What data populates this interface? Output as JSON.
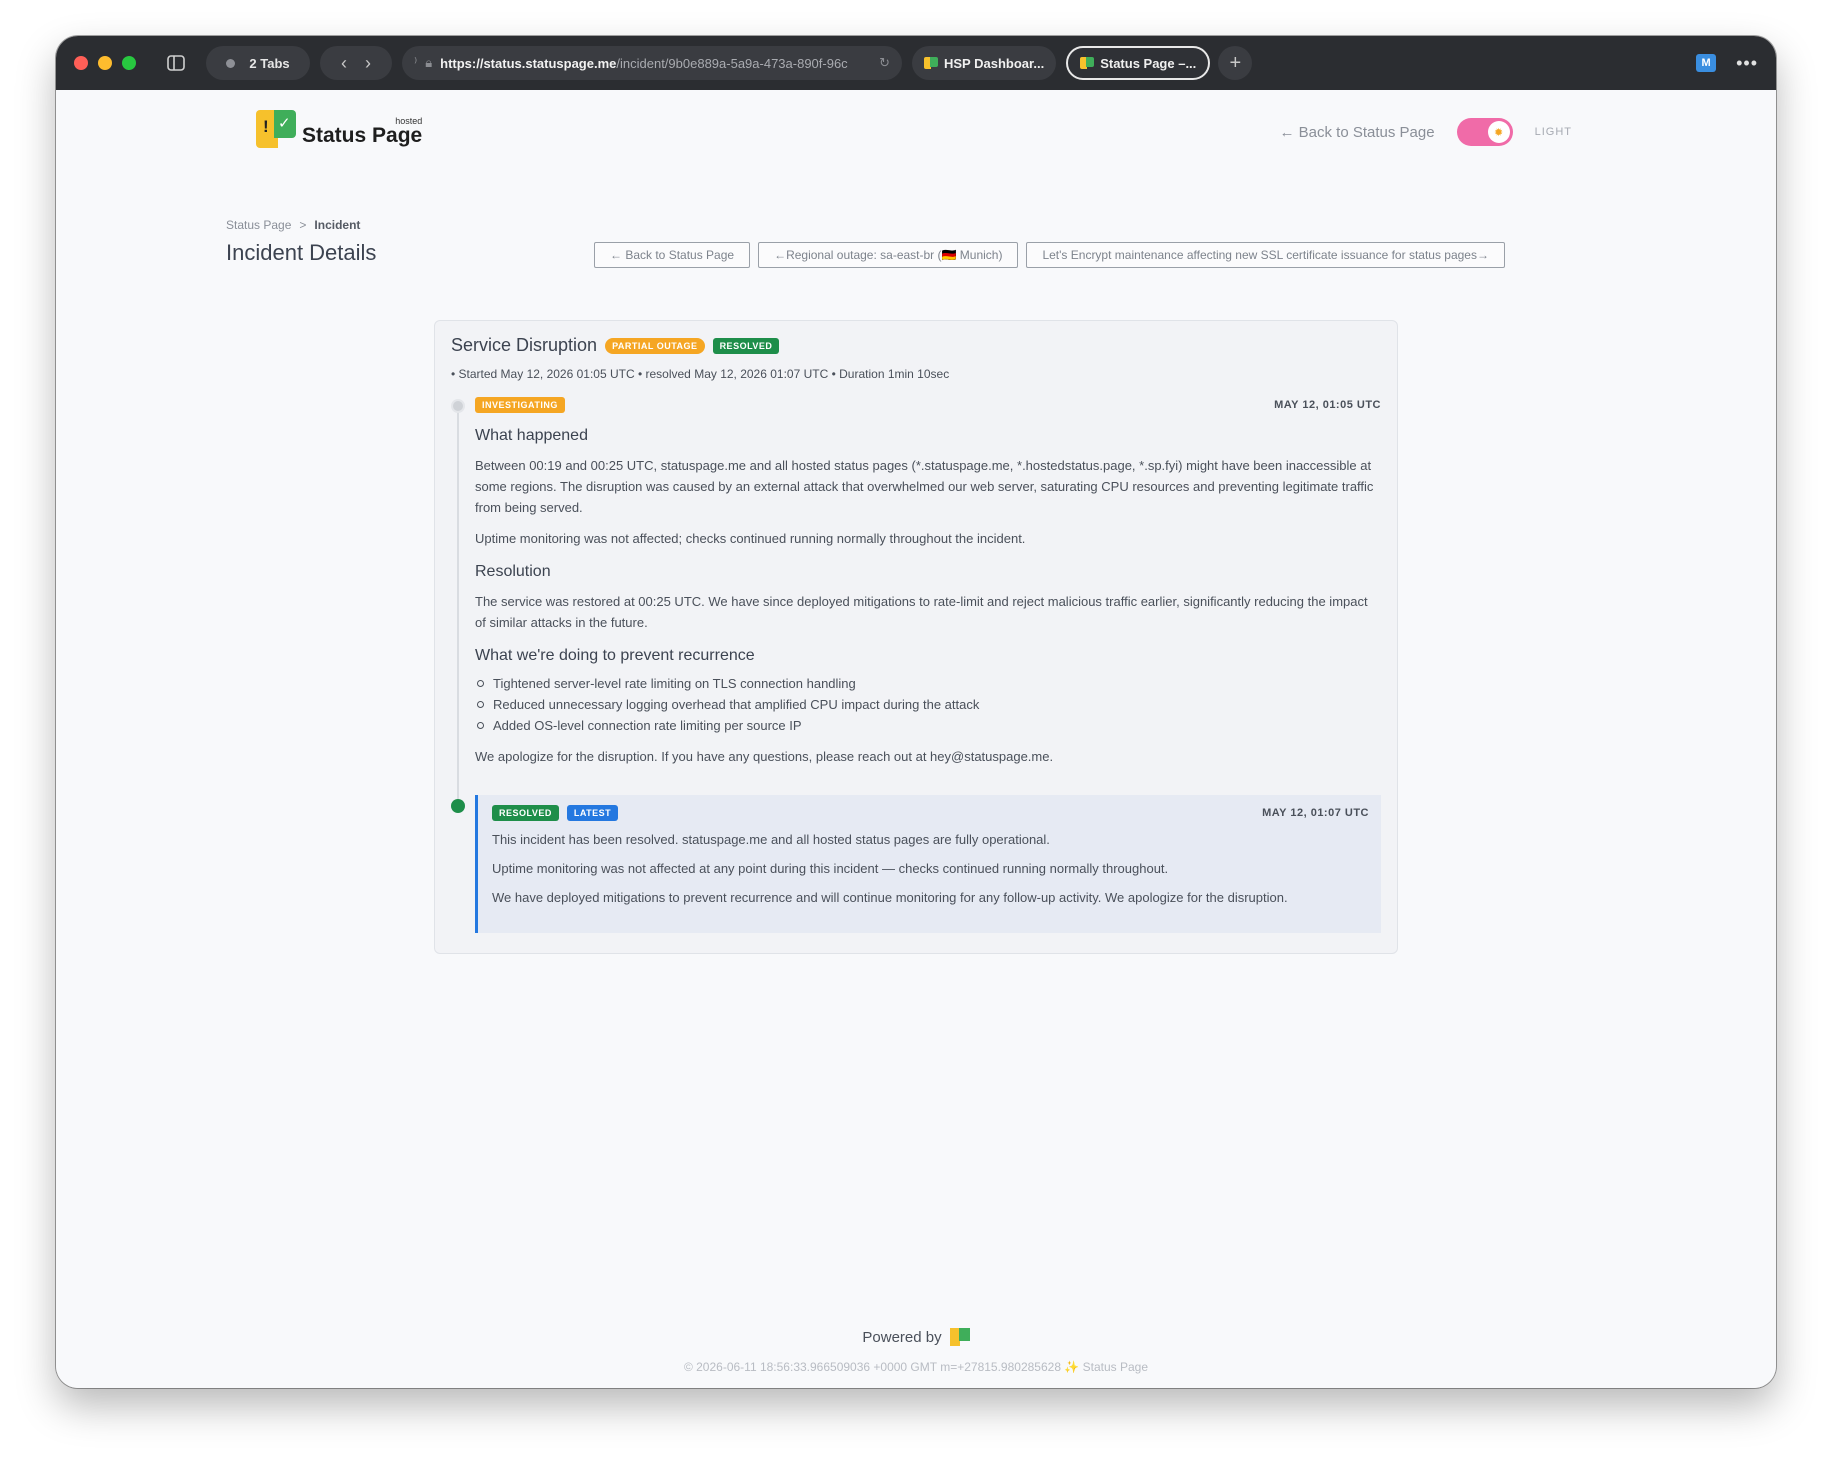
{
  "browser": {
    "tabs_count": "2 Tabs",
    "url_host": "https://status.statuspage.me",
    "url_path": "/incident/9b0e889a-5a9a-473a-890f-96c",
    "tab1": "HSP Dashboar...",
    "tab2": "Status Page –...",
    "ext_label": "M"
  },
  "header": {
    "logo_sup": "hosted",
    "logo_name": "Status Page",
    "back_link": "← Back to Status Page",
    "theme_label": "LIGHT"
  },
  "breadcrumb": {
    "root": "Status Page",
    "sep": ">",
    "current": "Incident"
  },
  "page_title": "Incident Details",
  "nav_buttons": {
    "back": "← Back to Status Page",
    "prev": "←Regional outage: sa-east-br (🇩🇪 Munich)",
    "next": "Let's Encrypt maintenance affecting new SSL certificate issuance for status pages→"
  },
  "incident": {
    "title": "Service Disruption",
    "impact_badge": "PARTIAL OUTAGE",
    "status_badge": "RESOLVED",
    "meta": "• Started May 12, 2026 01:05 UTC • resolved May 12, 2026 01:07 UTC • Duration 1min 10sec",
    "update1": {
      "badge": "INVESTIGATING",
      "time": "MAY 12, 01:05 UTC",
      "h1": "What happened",
      "p1": "Between 00:19 and 00:25 UTC, statuspage.me and all hosted status pages (*.statuspage.me, *.hostedstatus.page, *.sp.fyi) might have been inaccessible at some regions. The disruption was caused by an external attack that overwhelmed our web server, saturating CPU resources and preventing legitimate traffic from being served.",
      "p2": "Uptime monitoring was not affected; checks continued running normally throughout the incident.",
      "h2": "Resolution",
      "p3": "The service was restored at 00:25 UTC. We have since deployed mitigations to rate-limit and reject malicious traffic earlier, significantly reducing the impact of similar attacks in the future.",
      "h3": "What we're doing to prevent recurrence",
      "items": [
        "Tightened server-level rate limiting on TLS connection handling",
        "Reduced unnecessary logging overhead that amplified CPU impact during the attack",
        "Added OS-level connection rate limiting per source IP"
      ],
      "p4": "We apologize for the disruption. If you have any questions, please reach out at hey@statuspage.me."
    },
    "update2": {
      "badge": "RESOLVED",
      "latest": "LATEST",
      "time": "MAY 12, 01:07 UTC",
      "p1": "This incident has been resolved. statuspage.me and all hosted status pages are fully operational.",
      "p2": "Uptime monitoring was not affected at any point during this incident — checks continued running normally throughout.",
      "p3": "We have deployed mitigations to prevent recurrence and will continue monitoring for any follow-up activity. We apologize for the disruption."
    }
  },
  "footer": {
    "powered": "Powered by",
    "copyright": "© 2026-06-11 18:56:33.966509036 +0000 GMT m=+27815.980285628",
    "sparkle": "✨",
    "brand": "Status Page"
  },
  "colors": {
    "accent_blue": "#2478e0",
    "resolved_green": "#1e8e4a",
    "warning_orange": "#f5a623",
    "toggle_pink": "#f06ba8"
  }
}
